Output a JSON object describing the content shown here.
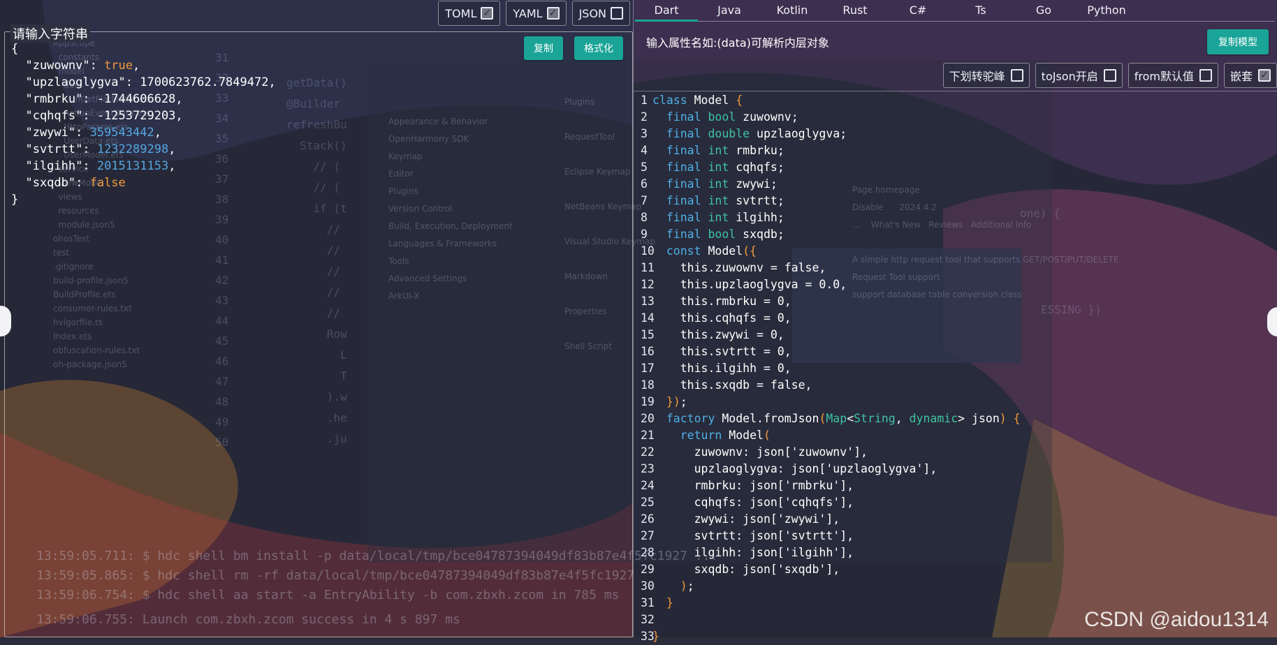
{
  "format_tabs": [
    {
      "label": "TOML",
      "checked": true
    },
    {
      "label": "YAML",
      "checked": true
    },
    {
      "label": "JSON",
      "checked": false
    }
  ],
  "input_panel": {
    "legend": "请输入字符串",
    "copy_label": "复制",
    "format_label": "格式化",
    "json_lines": [
      "{",
      "  \"zuwownv\": true,",
      "  \"upzlaoglygva\": 1700623762.7849472,",
      "  \"rmbrku\": -1744606628,",
      "  \"cqhqfs\": -1253729203,",
      "  \"zwywi\": 359543442,",
      "  \"svtrtt\": 1232289298,",
      "  \"ilgihh\": 2015131153,",
      "  \"sxqdb\": false",
      "}"
    ]
  },
  "languages": [
    "Dart",
    "Java",
    "Kotlin",
    "Rust",
    "C#",
    "Ts",
    "Go",
    "Python"
  ],
  "active_language": "Dart",
  "attr_input_placeholder": "输入属性名如:(data)可解析内层对象",
  "copy_model_label": "复制模型",
  "options": [
    {
      "label": "下划转驼峰",
      "checked": false
    },
    {
      "label": "toJson开启",
      "checked": false
    },
    {
      "label": "from默认值",
      "checked": false
    },
    {
      "label": "嵌套",
      "checked": true
    }
  ],
  "code_lines": [
    "class Model {",
    "  final bool zuwownv;",
    "  final double upzlaoglygva;",
    "  final int rmbrku;",
    "  final int cqhqfs;",
    "  final int zwywi;",
    "  final int svtrtt;",
    "  final int ilgihh;",
    "  final bool sxqdb;",
    "  const Model({",
    "    this.zuwownv = false,",
    "    this.upzlaoglygva = 0.0,",
    "    this.rmbrku = 0,",
    "    this.cqhqfs = 0,",
    "    this.zwywi = 0,",
    "    this.svtrtt = 0,",
    "    this.ilgihh = 0,",
    "    this.sxqdb = false,",
    "  });",
    "  factory Model.fromJson(Map<String, dynamic> json) {",
    "    return Model(",
    "      zuwownv: json['zuwownv'],",
    "      upzlaoglygva: json['upzlaoglygva'],",
    "      rmbrku: json['rmbrku'],",
    "      cqhqfs: json['cqhqfs'],",
    "      zwywi: json['zwywi'],",
    "      svtrtt: json['svtrtt'],",
    "      ilgihh: json['ilgihh'],",
    "      sxqdb: json['sxqdb'],",
    "    );",
    "  }",
    "",
    "}"
  ],
  "watermark": "CSDN @aidou1314",
  "background_log": [
    "13:59:05.711: $ hdc shell bm install -p data/local/tmp/bce04787394049df83b87e4f5fc1927 ...",
    "13:59:05.865: $ hdc shell rm -rf data/local/tmp/bce04787394049df83b87e4f5fc1927",
    "13:59:06.754: $ hdc shell aa start -a EntryAbility -b com.zbxh.zcom in 785 ms",
    "13:59:06.755: Launch com.zbxh.zcom success in 4 s 897 ms"
  ],
  "colors": {
    "accent": "#1aa497",
    "keyword": "#4fb0e8",
    "type": "#3fc3a3",
    "bool": "#f29b3d",
    "number_blue": "#55a6e0"
  }
}
